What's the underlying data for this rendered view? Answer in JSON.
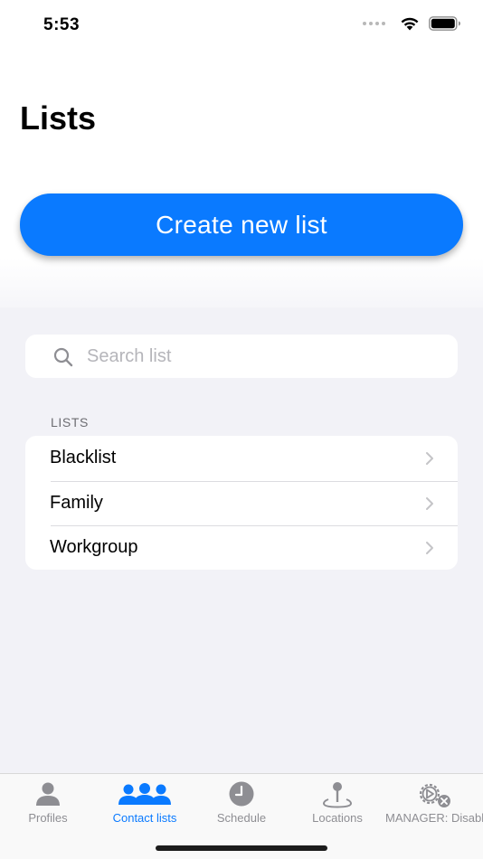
{
  "status_bar": {
    "time": "5:53"
  },
  "page": {
    "title": "Lists",
    "create_button_label": "Create new list"
  },
  "search": {
    "placeholder": "Search list",
    "value": ""
  },
  "lists_section": {
    "header": "LISTS",
    "items": [
      {
        "label": "Blacklist"
      },
      {
        "label": "Family"
      },
      {
        "label": "Workgroup"
      }
    ]
  },
  "tab_bar": {
    "tabs": [
      {
        "label": "Profiles",
        "icon": "person-icon",
        "active": false
      },
      {
        "label": "Contact lists",
        "icon": "group-icon",
        "active": true
      },
      {
        "label": "Schedule",
        "icon": "clock-icon",
        "active": false
      },
      {
        "label": "Locations",
        "icon": "location-pin-icon",
        "active": false
      },
      {
        "label": "MANAGER: Disabled",
        "icon": "gear-disabled-icon",
        "active": false
      }
    ]
  },
  "colors": {
    "accent": "#0a7aff",
    "background": "#f2f2f7",
    "inactive_tab": "#8e8e93"
  }
}
